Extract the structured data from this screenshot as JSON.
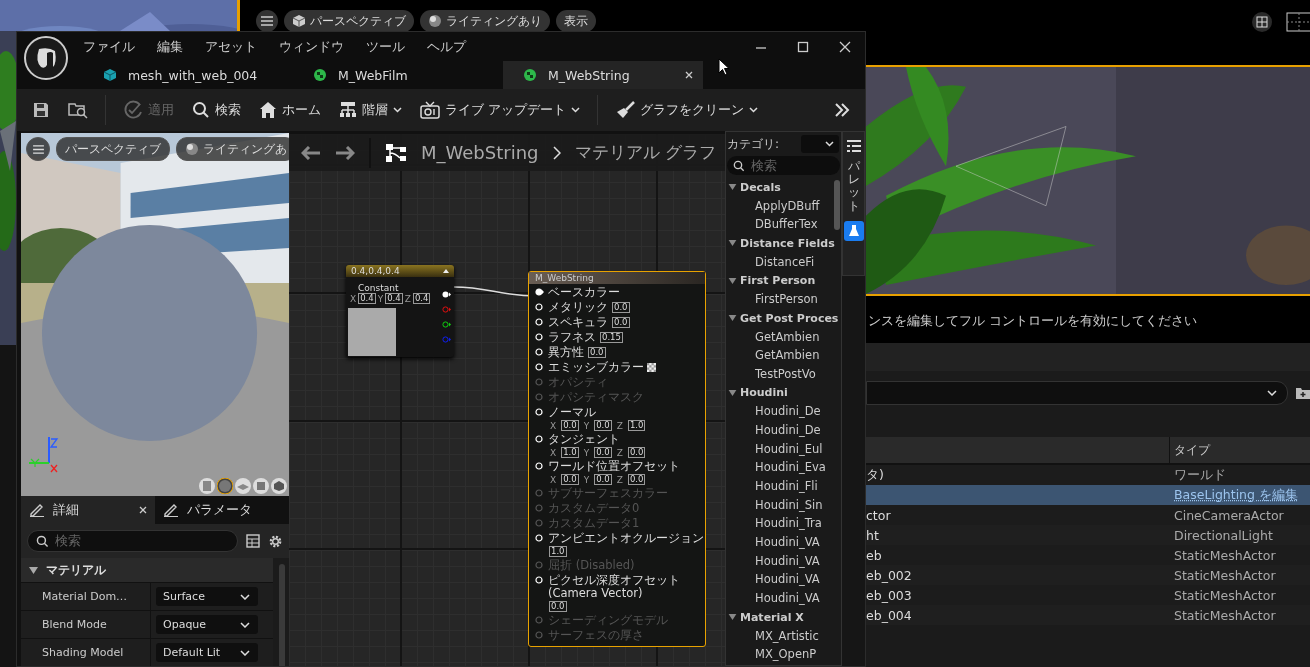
{
  "background_toolbar": [
    {
      "kind": "cube",
      "label": "パースペクティブ"
    },
    {
      "kind": "sphere",
      "label": "ライティングあり"
    },
    {
      "kind": "plain",
      "label": "表示"
    }
  ],
  "hint": "ンスを編集してフル コントロールを有効にしてください",
  "outliner": {
    "columns": [
      "タイプ"
    ],
    "rows": [
      {
        "name": "タ)",
        "type": "ワールド",
        "kind": "text",
        "selected": false
      },
      {
        "name": "",
        "type": "BaseLighting を編集",
        "kind": "link",
        "selected": true
      },
      {
        "name": "ctor",
        "type": "CineCameraActor",
        "kind": "text",
        "selected": false
      },
      {
        "name": "ht",
        "type": "DirectionalLight",
        "kind": "text",
        "selected": false
      },
      {
        "name": "eb",
        "type": "StaticMeshActor",
        "kind": "text",
        "selected": false
      },
      {
        "name": "eb_002",
        "type": "StaticMeshActor",
        "kind": "text",
        "selected": false
      },
      {
        "name": "eb_003",
        "type": "StaticMeshActor",
        "kind": "text",
        "selected": false
      },
      {
        "name": "eb_004",
        "type": "StaticMeshActor",
        "kind": "text",
        "selected": false
      }
    ]
  },
  "editor": {
    "menu": [
      "ファイル",
      "編集",
      "アセット",
      "ウィンドウ",
      "ツール",
      "ヘルプ"
    ],
    "tabs": [
      {
        "label": "mesh_with_web_004",
        "kind": "mesh",
        "selected": false
      },
      {
        "label": "M_WebFilm",
        "kind": "material",
        "selected": false
      },
      {
        "label": "M_WebString",
        "kind": "material",
        "selected": true
      }
    ],
    "toolbar": [
      {
        "kind": "save"
      },
      {
        "kind": "browse"
      },
      {
        "kind": "apply",
        "label": "適用",
        "disabled": true,
        "dropdown": false
      },
      {
        "kind": "search",
        "label": "検索",
        "disabled": false,
        "dropdown": false
      },
      {
        "kind": "home",
        "label": "ホーム",
        "disabled": false,
        "dropdown": false
      },
      {
        "kind": "hierarchy",
        "label": "階層",
        "disabled": false,
        "dropdown": true
      },
      {
        "kind": "live",
        "label": "ライブ アップデート",
        "disabled": false,
        "dropdown": true
      },
      {
        "kind": "clean",
        "label": "グラフをクリーン",
        "disabled": false,
        "dropdown": true
      }
    ],
    "viewport_buttons": [
      {
        "kind": "plain",
        "label": "パースペクティブ"
      },
      {
        "kind": "sphere",
        "label": "ライティングあ"
      }
    ],
    "details_tabs": [
      {
        "label": "詳細",
        "selected": true
      },
      {
        "label": "パラメータ",
        "selected": false
      }
    ],
    "details_search": {
      "placeholder": "検索"
    },
    "category": {
      "label": "マテリアル",
      "expanded": true
    },
    "properties": [
      {
        "name": "Material Dom…",
        "value": "Surface"
      },
      {
        "name": "Blend Mode",
        "value": "Opaque"
      },
      {
        "name": "Shading Model",
        "value": "Default Lit"
      }
    ],
    "breadcrumb": {
      "asset": "M_WebString",
      "graph": "マテリアル グラフ"
    },
    "constant_node": {
      "title": "0.4,0.4,0.4",
      "label": "Constant",
      "components": [
        {
          "axis": "X",
          "value": "0.4"
        },
        {
          "axis": "Y",
          "value": "0.4"
        },
        {
          "axis": "Z",
          "value": "0.4"
        }
      ]
    },
    "material_node": {
      "title": "M_WebString",
      "pins": [
        {
          "label": "ベースカラー",
          "kind": "plain",
          "connected": true,
          "disabled": false
        },
        {
          "label": "メタリック",
          "kind": "scalar",
          "value": "0.0",
          "connected": false,
          "disabled": false
        },
        {
          "label": "スペキュラ",
          "kind": "scalar",
          "value": "0.0",
          "connected": false,
          "disabled": false
        },
        {
          "label": "ラフネス",
          "kind": "scalar",
          "value": "0.15",
          "connected": false,
          "disabled": false
        },
        {
          "label": "異方性",
          "kind": "scalar",
          "value": "0.0",
          "connected": false,
          "disabled": false
        },
        {
          "label": "エミッシブカラー",
          "kind": "swatch",
          "connected": false,
          "disabled": false
        },
        {
          "label": "オパシティ",
          "kind": "plain",
          "connected": false,
          "disabled": true
        },
        {
          "label": "オパシティマスク",
          "kind": "plain",
          "connected": false,
          "disabled": true
        },
        {
          "label": "ノーマル",
          "kind": "vector",
          "components": [
            {
              "axis": "X",
              "value": "0.0"
            },
            {
              "axis": "Y",
              "value": "0.0"
            },
            {
              "axis": "Z",
              "value": "1.0"
            }
          ],
          "connected": false,
          "disabled": false
        },
        {
          "label": "タンジェント",
          "kind": "vector",
          "components": [
            {
              "axis": "X",
              "value": "1.0"
            },
            {
              "axis": "Y",
              "value": "0.0"
            },
            {
              "axis": "Z",
              "value": "0.0"
            }
          ],
          "connected": false,
          "disabled": false
        },
        {
          "label": "ワールド位置オフセット",
          "kind": "vector",
          "components": [
            {
              "axis": "X",
              "value": "0.0"
            },
            {
              "axis": "Y",
              "value": "0.0"
            },
            {
              "axis": "Z",
              "value": "0.0"
            }
          ],
          "connected": false,
          "disabled": false
        },
        {
          "label": "サブサーフェスカラー",
          "kind": "plain",
          "connected": false,
          "disabled": true
        },
        {
          "label": "カスタムデータ0",
          "kind": "plain",
          "connected": false,
          "disabled": true
        },
        {
          "label": "カスタムデータ1",
          "kind": "plain",
          "connected": false,
          "disabled": true
        },
        {
          "label": "アンビエントオクルージョン",
          "kind": "scalar_below",
          "value": "1.0",
          "connected": false,
          "disabled": false
        },
        {
          "label": "屈折 (Disabled)",
          "kind": "plain",
          "connected": false,
          "disabled": true
        },
        {
          "label": "ピクセル深度オフセット (Camera Vector)",
          "kind": "scalar_below",
          "value": "0.0",
          "connected": false,
          "disabled": false
        },
        {
          "label": "シェーディングモデル",
          "kind": "plain",
          "connected": false,
          "disabled": true
        },
        {
          "label": "サーフェスの厚さ",
          "kind": "plain",
          "connected": false,
          "disabled": true
        }
      ]
    },
    "palette": {
      "category_label": "カテゴリ:",
      "search": {
        "placeholder": "検索"
      },
      "tab": "パレット",
      "groups": [
        {
          "label": "Decals",
          "expanded": true,
          "children": [
            {
              "label": "ApplyDBuff"
            },
            {
              "label": "DBufferTex"
            }
          ]
        },
        {
          "label": "Distance Fields",
          "expanded": true,
          "children": [
            {
              "label": "DistanceFi"
            }
          ]
        },
        {
          "label": "First Person",
          "expanded": true,
          "children": [
            {
              "label": "FirstPerson"
            }
          ]
        },
        {
          "label": "Get Post Proces",
          "expanded": true,
          "children": [
            {
              "label": "GetAmbien"
            },
            {
              "label": "GetAmbien"
            },
            {
              "label": "TestPostVo"
            }
          ]
        },
        {
          "label": "Houdini",
          "expanded": true,
          "children": [
            {
              "label": "Houdini_De"
            },
            {
              "label": "Houdini_De"
            },
            {
              "label": "Houdini_Eul"
            },
            {
              "label": "Houdini_Eva"
            },
            {
              "label": "Houdini_Fli"
            },
            {
              "label": "Houdini_Sin"
            },
            {
              "label": "Houdini_Tra"
            },
            {
              "label": "Houdini_VA"
            },
            {
              "label": "Houdini_VA"
            },
            {
              "label": "Houdini_VA"
            },
            {
              "label": "Houdini_VA"
            }
          ]
        },
        {
          "label": "Material X",
          "expanded": true,
          "children": [
            {
              "label": "MX_Artistic"
            },
            {
              "label": "MX_OpenP"
            }
          ]
        }
      ]
    }
  }
}
